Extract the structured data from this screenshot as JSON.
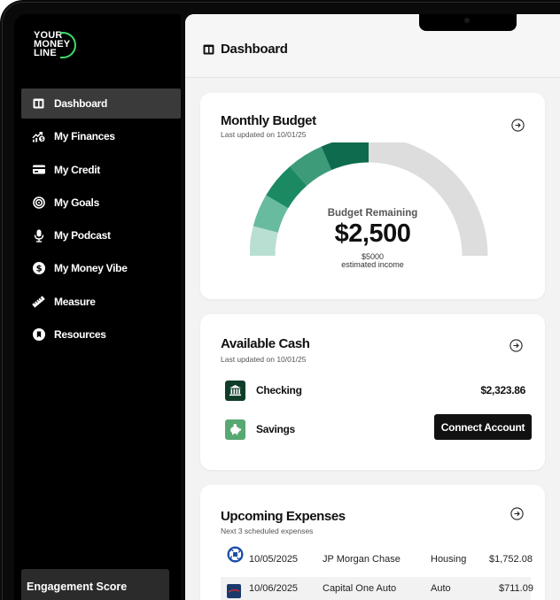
{
  "logo": {
    "line1": "YOUR",
    "line2": "MONEY",
    "line3": "LINE"
  },
  "nav": [
    {
      "label": "Dashboard",
      "icon": "dashboard-icon",
      "active": true
    },
    {
      "label": "My Finances",
      "icon": "finances-icon"
    },
    {
      "label": "My Credit",
      "icon": "credit-card-icon"
    },
    {
      "label": "My Goals",
      "icon": "target-icon"
    },
    {
      "label": "My Podcast",
      "icon": "microphone-icon"
    },
    {
      "label": "My Money Vibe",
      "icon": "dollar-icon"
    },
    {
      "label": "Measure",
      "icon": "ruler-icon"
    },
    {
      "label": "Resources",
      "icon": "bookmark-icon"
    }
  ],
  "engagement": {
    "label": "Engagement Score"
  },
  "header": {
    "title": "Dashboard"
  },
  "budget": {
    "title": "Monthly Budget",
    "updated": "Last updated on 10/01/25",
    "caption": "Budget Remaining",
    "amount": "$2,500",
    "income_amount": "$5000",
    "income_label": "estimated income",
    "spent_fraction": 0.5,
    "colors": {
      "dark": "#0e6b4d",
      "mid": "#1b8a63",
      "light": "#69bba0",
      "pale": "#b9dfd2",
      "track": "#dddddd"
    }
  },
  "cash": {
    "title": "Available Cash",
    "updated": "Last updated on 10/01/25",
    "checking": {
      "label": "Checking",
      "amount": "$2,323.86"
    },
    "savings": {
      "label": "Savings",
      "button": "Connect Account"
    }
  },
  "expenses": {
    "title": "Upcoming Expenses",
    "subtitle": "Next 3 scheduled expenses",
    "rows": [
      {
        "date": "10/05/2025",
        "payee": "JP Morgan Chase",
        "category": "Housing",
        "amount": "$1,752.08",
        "logo": "chase-logo"
      },
      {
        "date": "10/06/2025",
        "payee": "Capital One Auto",
        "category": "Auto",
        "amount": "$711.09",
        "logo": "capital-one-logo"
      }
    ]
  }
}
